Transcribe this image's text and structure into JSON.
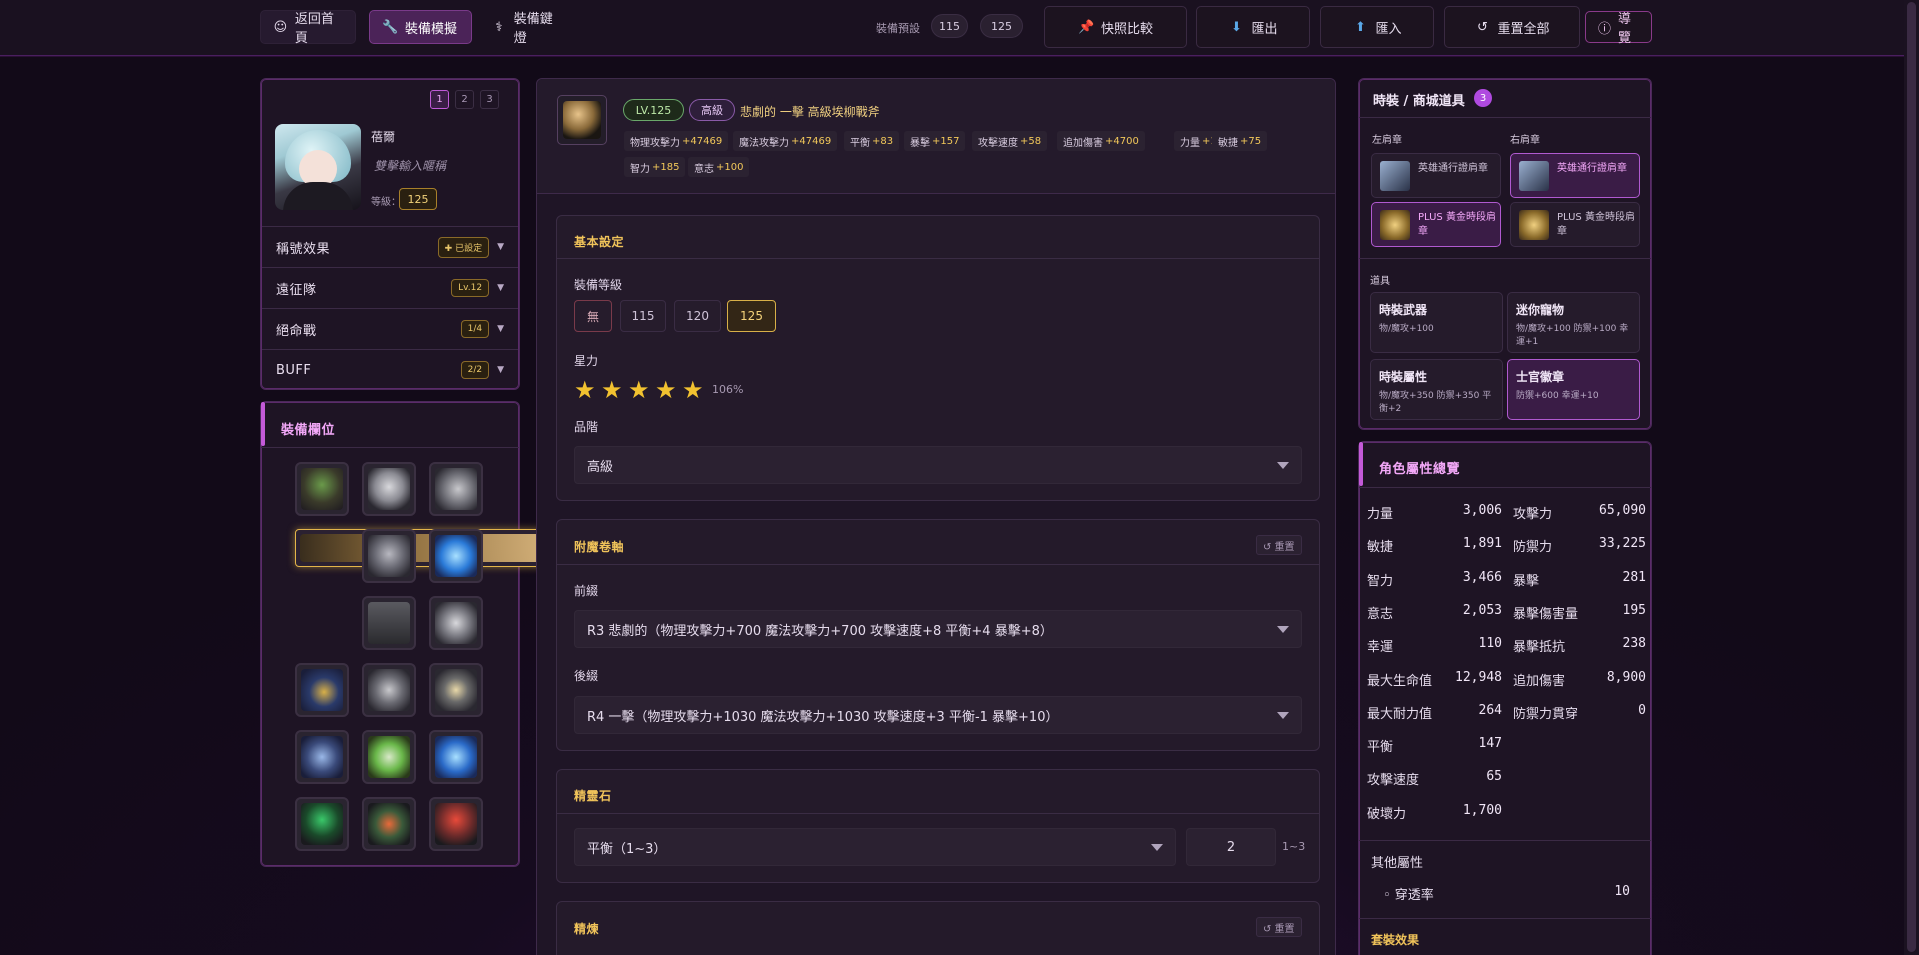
{
  "topbar": {
    "home": "返回首頁",
    "simulate": "裝備模擬",
    "hotkey": "裝備鍵燈",
    "preset_label": "裝備預設",
    "preset_a": "115",
    "preset_b": "125",
    "compare": "快照比較",
    "export": "匯出",
    "import": "匯入",
    "reset_all": "重置全部",
    "guide": "導覽"
  },
  "left": {
    "pages": [
      "1",
      "2",
      "3"
    ],
    "char_name": "蓓爾",
    "char_title": "雙擊輸入暱稱",
    "level_label": "等級：",
    "level_value": "125",
    "accordion": [
      {
        "title": "稱號效果",
        "badge": "✚ 已設定"
      },
      {
        "title": "遠征隊",
        "badge": "Lv.12"
      },
      {
        "title": "絕命戰",
        "badge": "1/4"
      },
      {
        "title": "BUFF",
        "badge": "2/2"
      }
    ],
    "slots_title": "裝備欄位"
  },
  "weapon": {
    "level_tag": "LV.125",
    "grade_tag": "高級",
    "name": "悲劇的 一擊 高級埃柳戰斧",
    "stats": [
      {
        "k": "物理攻擊力",
        "v": "+47469"
      },
      {
        "k": "魔法攻擊力",
        "v": "+47469"
      },
      {
        "k": "平衡",
        "v": "+83"
      },
      {
        "k": "暴擊",
        "v": "+157"
      },
      {
        "k": "攻擊速度",
        "v": "+58"
      },
      {
        "k": "追加傷害",
        "v": "+4700"
      },
      {
        "k": "力量",
        "v": "+137"
      },
      {
        "k": "敏捷",
        "v": "+75"
      },
      {
        "k": "智力",
        "v": "+185"
      },
      {
        "k": "意志",
        "v": "+100"
      }
    ]
  },
  "basic": {
    "title": "基本設定",
    "level_label": "裝備等級",
    "levels": [
      "無",
      "115",
      "120",
      "125"
    ],
    "star_label": "星力",
    "stars": 5,
    "star_pct": "106%",
    "grade_label": "品階",
    "grade_value": "高級"
  },
  "enchant": {
    "title": "附魔卷軸",
    "reset": "↺ 重置",
    "prefix_label": "前綴",
    "prefix_value": "R3 悲劇的（物理攻擊力+700 魔法攻擊力+700 攻擊速度+8 平衡+4 暴擊+8）",
    "suffix_label": "後綴",
    "suffix_value": "R4 一擊（物理攻擊力+1030 魔法攻擊力+1030 攻擊速度+3 平衡-1 暴擊+10）"
  },
  "spirit": {
    "title": "精靈石",
    "select": "平衡（1~3）",
    "value": "2",
    "range": "1~3"
  },
  "refine": {
    "title": "精煉",
    "reset": "↺ 重置"
  },
  "fashion": {
    "title": "時裝 / 商城道具",
    "count": "3",
    "left_label": "左肩章",
    "right_label": "右肩章",
    "shoulders": [
      {
        "name": "英雄通行證肩章"
      },
      {
        "name": "英雄通行證肩章"
      },
      {
        "name": "PLUS 黃金時段肩章"
      },
      {
        "name": "PLUS 黃金時段肩章"
      }
    ],
    "items_label": "道具",
    "items": [
      {
        "name": "時裝武器",
        "desc": "物/魔攻+100"
      },
      {
        "name": "迷你寵物",
        "desc": "物/魔攻+100 防禦+100 幸運+1"
      },
      {
        "name": "時裝屬性",
        "desc": "物/魔攻+350 防禦+350 平衡+2"
      },
      {
        "name": "士官徽章",
        "desc": "防禦+600 幸運+10"
      }
    ]
  },
  "overview": {
    "title": "角色屬性總覽",
    "left": [
      {
        "k": "力量",
        "v": "3,006"
      },
      {
        "k": "敏捷",
        "v": "1,891"
      },
      {
        "k": "智力",
        "v": "3,466"
      },
      {
        "k": "意志",
        "v": "2,053"
      },
      {
        "k": "幸運",
        "v": "110"
      },
      {
        "k": "最大生命值",
        "v": "12,948"
      },
      {
        "k": "最大耐力值",
        "v": "264"
      },
      {
        "k": "平衡",
        "v": "147"
      },
      {
        "k": "攻擊速度",
        "v": "65"
      },
      {
        "k": "破壞力",
        "v": "1,700"
      }
    ],
    "right": [
      {
        "k": "攻擊力",
        "v": "65,090"
      },
      {
        "k": "防禦力",
        "v": "33,225"
      },
      {
        "k": "暴擊",
        "v": "281"
      },
      {
        "k": "暴擊傷害量",
        "v": "195"
      },
      {
        "k": "暴擊抵抗",
        "v": "238"
      },
      {
        "k": "追加傷害",
        "v": "8,900"
      },
      {
        "k": "防禦力貫穿",
        "v": "0"
      }
    ],
    "other_label": "其他屬性",
    "other_k": "◦ 穿透率",
    "other_v": "10",
    "set_label": "套裝效果"
  }
}
